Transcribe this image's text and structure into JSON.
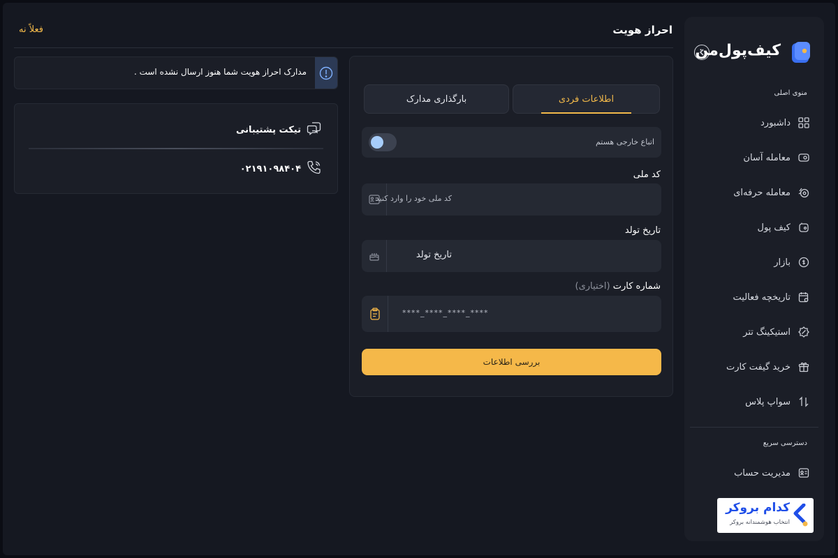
{
  "header": {
    "title": "احراز هویت",
    "inactive_label": "فعلاً نه"
  },
  "sidebar": {
    "logo_text": "کیف‌پول‌من",
    "main_menu_label": "منوی اصلی",
    "items": [
      {
        "label": "داشبورد",
        "icon": "dashboard-icon"
      },
      {
        "label": "معامله آسان",
        "icon": "easy-trade-icon"
      },
      {
        "label": "معامله حرفه‌ای",
        "icon": "pro-trade-icon"
      },
      {
        "label": "کیف پول",
        "icon": "wallet-icon"
      },
      {
        "label": "بازار",
        "icon": "market-icon"
      },
      {
        "label": "تاریخچه فعالیت",
        "icon": "history-icon"
      },
      {
        "label": "استیکینگ تتر",
        "icon": "staking-icon"
      },
      {
        "label": "خرید گیفت کارت",
        "icon": "gift-card-icon"
      },
      {
        "label": "سواپ پلاس",
        "icon": "swap-icon"
      }
    ],
    "quick_access_label": "دسترسی سریع",
    "quick_items": [
      {
        "label": "مدیریت حساب",
        "icon": "account-icon"
      }
    ],
    "broker": {
      "title": "کدام بروکر",
      "subtitle": "انتخاب هوشمندانه بروکر"
    }
  },
  "form": {
    "tabs": [
      {
        "label": "اطلاعات فردی",
        "active": true
      },
      {
        "label": "بارگذاری مدارک",
        "active": false
      }
    ],
    "foreign_toggle_label": "اتباع خارجی هستم",
    "foreign_toggle_on": false,
    "national_code": {
      "label": "کد ملی",
      "placeholder": "کد ملی خود را وارد کنید"
    },
    "birth_date": {
      "label": "تاریخ تولد",
      "placeholder": "تاریخ تولد"
    },
    "card_number": {
      "label": "شماره کارت",
      "optional": "(اختیاری)",
      "placeholder": "****_****_****_****"
    },
    "submit_label": "بررسی اطلاعات"
  },
  "alert": {
    "text": "مدارک احراز هویت شما هنوز ارسال نشده است ."
  },
  "support": {
    "ticket_label": "تیکت پشتیبانی",
    "phone": "۰۲۱۹۱۰۹۸۴۰۴"
  },
  "colors": {
    "accent": "#f5b849",
    "background": "#151821",
    "card": "#1b1e27",
    "info": "#5b9cf5"
  }
}
